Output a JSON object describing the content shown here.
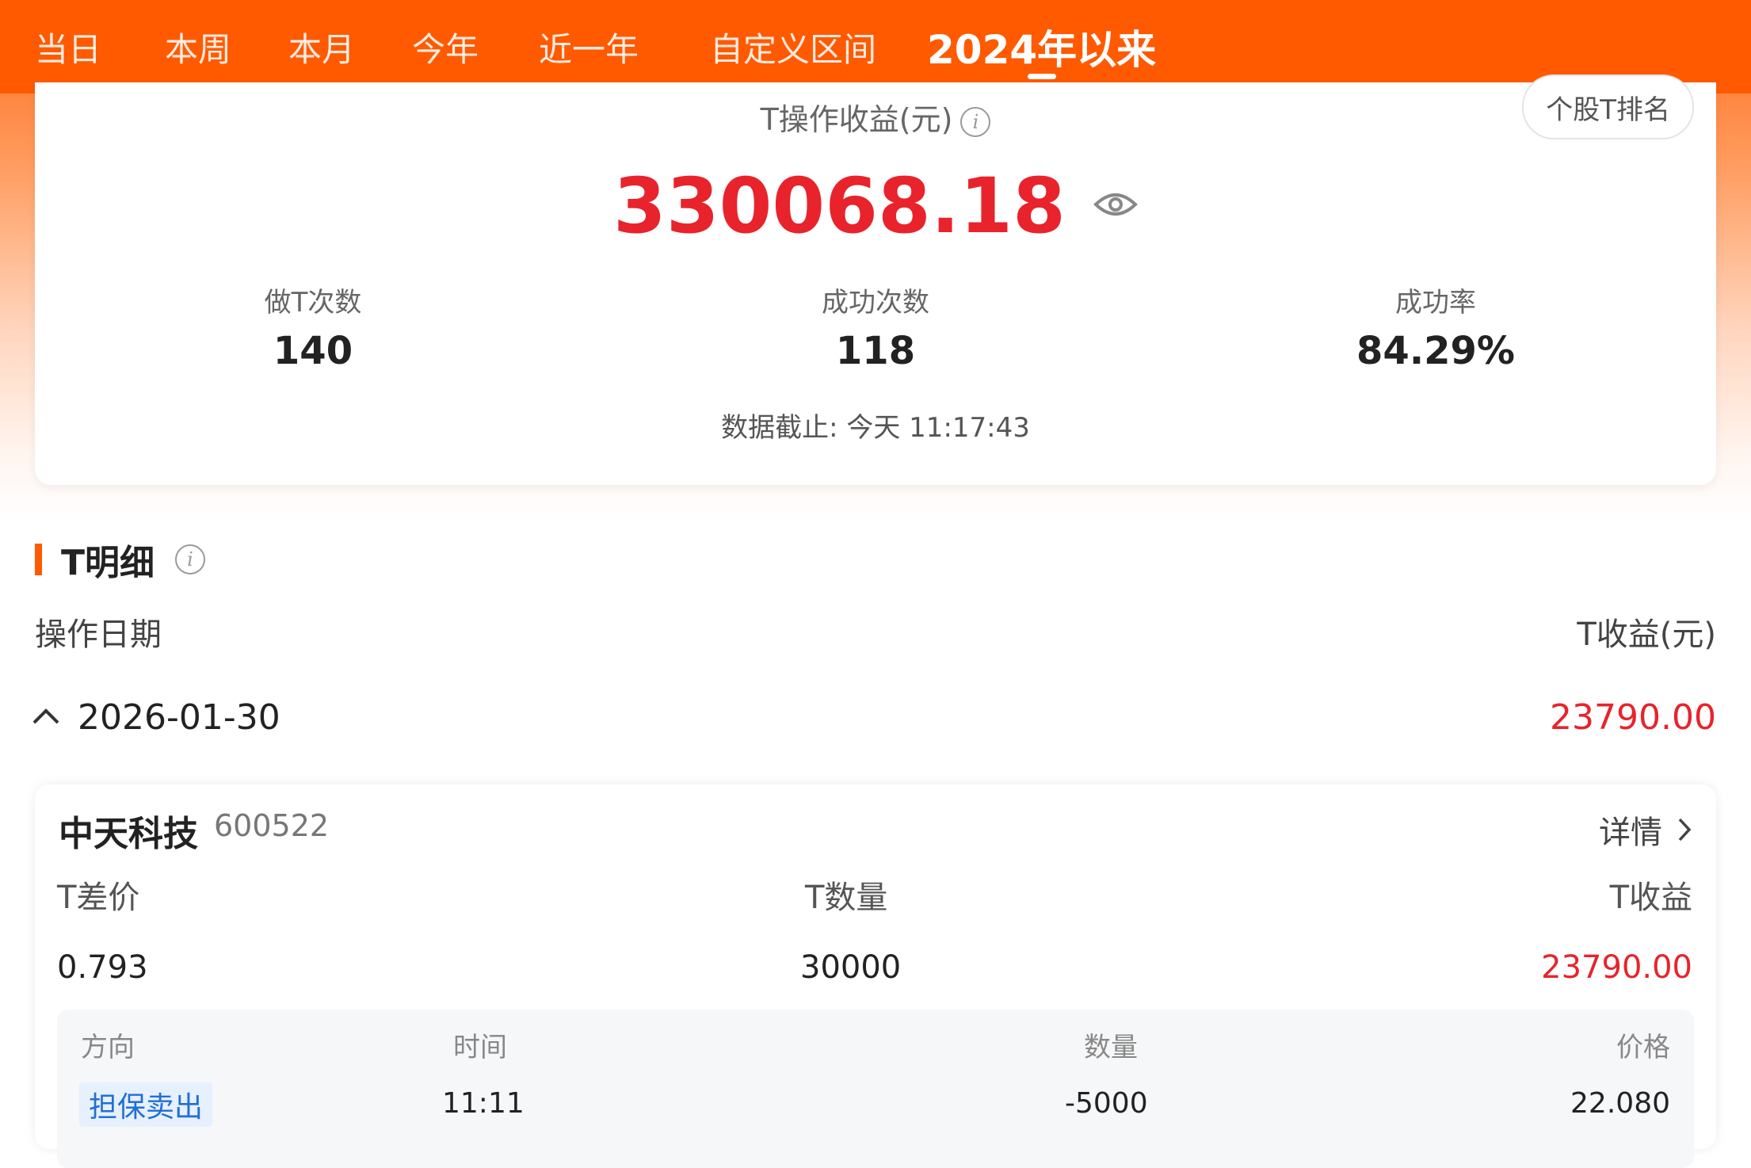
{
  "nav": {
    "tabs": [
      {
        "label": "当日"
      },
      {
        "label": "本周"
      },
      {
        "label": "本月"
      },
      {
        "label": "今年"
      },
      {
        "label": "近一年"
      },
      {
        "label": "自定义区间"
      },
      {
        "label": "2024年以来",
        "active": true
      }
    ]
  },
  "summary": {
    "rank_button": "个股T排名",
    "title": "T操作收益(元)",
    "amount": "330068.18",
    "stats": [
      {
        "label": "做T次数",
        "value": "140"
      },
      {
        "label": "成功次数",
        "value": "118"
      },
      {
        "label": "成功率",
        "value": "84.29%"
      }
    ],
    "as_of": "数据截止: 今天 11:17:43"
  },
  "detail": {
    "title": "T明细",
    "col_date": "操作日期",
    "col_income": "T收益(元)",
    "date": "2026-01-30",
    "date_income": "23790.00"
  },
  "stock": {
    "name": "中天科技",
    "code": "600522",
    "detail_label": "详情",
    "headers": {
      "diff": "T差价",
      "qty": "T数量",
      "income": "T收益"
    },
    "values": {
      "diff": "0.793",
      "qty": "30000",
      "income": "23790.00"
    },
    "trades_header": {
      "dir": "方向",
      "time": "时间",
      "qty": "数量",
      "price": "价格"
    },
    "trades": [
      {
        "dir": "担保卖出",
        "time": "11:11",
        "qty": "-5000",
        "price": "22.080"
      }
    ]
  },
  "colors": {
    "brand": "#ff5a00",
    "up": "#e8232c",
    "badge": "#1f6fd6"
  }
}
